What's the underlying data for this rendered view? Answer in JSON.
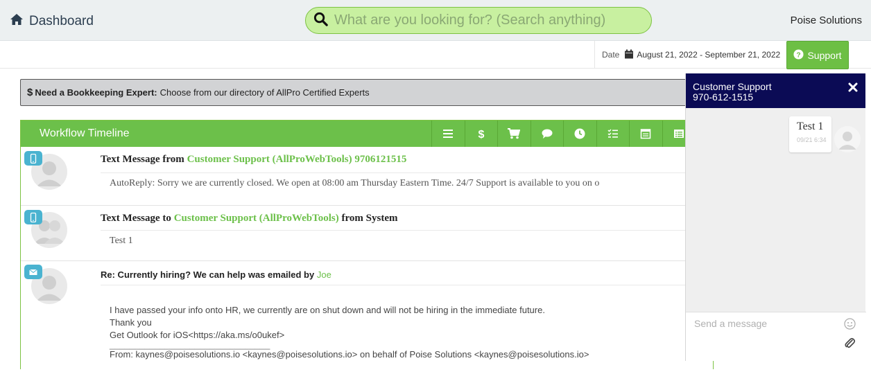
{
  "header": {
    "brand_label": "Dashboard",
    "search_placeholder": "What are you looking for? (Search anything)",
    "company": "Poise Solutions"
  },
  "subbar": {
    "date_label": "Date",
    "date_range": "August 21, 2022 - September 21, 2022",
    "support_label": "Support"
  },
  "banner": {
    "bold": "Need a Bookkeeping Expert:",
    "text": "Choose from our directory of AllPro Certified Experts"
  },
  "workflow": {
    "title": "Workflow Timeline",
    "toolbar_icons": [
      "list-icon",
      "dollar-icon",
      "cart-icon",
      "comment-icon",
      "clock-icon",
      "tasks-icon",
      "calendar-icon",
      "table-icon"
    ],
    "entries": [
      {
        "type": "sms",
        "title_prefix": "Text Message from",
        "title_link": "Customer Support (AllProWebTools) 9706121515",
        "title_suffix": "",
        "body": "AutoReply: Sorry we are currently closed. We open at 08:00 am Thursday Eastern Time. 24/7 Support is available to you on o"
      },
      {
        "type": "sms",
        "title_prefix": "Text Message to",
        "title_link": "Customer Support (AllProWebTools)",
        "title_suffix": "from System",
        "body": "Test 1"
      },
      {
        "type": "email",
        "title_prefix": "Re: Currently hiring? We can help was emailed by",
        "title_link": "Joe",
        "body_lines": [
          "I have passed your info onto HR, we currently are on shut down and will not be hiring in the immediate future.",
          "Thank you",
          "Get Outlook for iOS<https://aka.ms/o0ukef>",
          "________________________________",
          "From: kaynes@poisesolutions.io <kaynes@poisesolutions.io> on behalf of Poise Solutions <kaynes@poisesolutions.io>"
        ]
      }
    ]
  },
  "chat": {
    "title": "Customer Support",
    "phone": "970-612-1515",
    "messages": [
      {
        "text": "Test 1",
        "time": "09/21 6:34"
      }
    ],
    "input_placeholder": "Send a message"
  },
  "colors": {
    "accent_green": "#6cc04a",
    "search_bg": "#c8f0a0",
    "chat_header": "#0b0b55",
    "badge_blue": "#4ab3d0",
    "topbar_bg": "#ecf0f1"
  }
}
